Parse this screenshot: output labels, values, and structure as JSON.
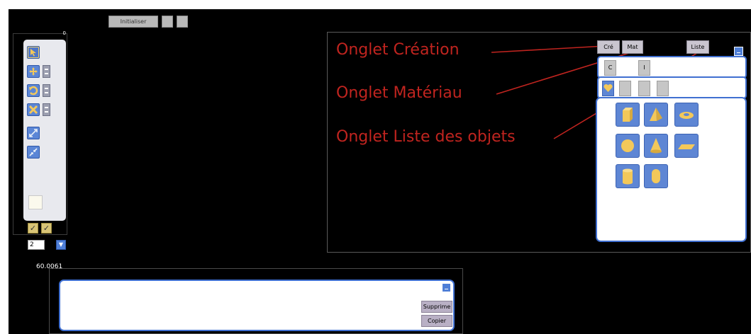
{
  "top_toolbar": {
    "buttons": [
      {
        "label": "Initialiser"
      },
      {
        "label": ""
      },
      {
        "label": ""
      }
    ]
  },
  "left_panel": {
    "top_marker": "0",
    "tools": [
      "select-arrow",
      "move",
      "rotate",
      "scale",
      "zoom-in",
      "zoom-out"
    ],
    "mode_value": "2",
    "dropdown_glyph": "▼",
    "fps": "60.0061"
  },
  "annotations": {
    "creation": "Onglet Création",
    "material": "Onglet Matériau",
    "object_list": "Onglet Liste des objets"
  },
  "right_panel": {
    "tabs": {
      "creation": "Cré",
      "material": "Mat",
      "list": "Liste"
    },
    "mode_buttons": [
      "C",
      "I"
    ],
    "category_icon": "heart-icon",
    "shapes": [
      "cube",
      "pyramid",
      "torus",
      "sphere",
      "cone",
      "plane",
      "cylinder",
      "capsule"
    ]
  },
  "bottom_panel": {
    "delete_label": "Supprime",
    "copy_label": "Copier"
  },
  "colors": {
    "accent": "#4f7fd7",
    "annotation": "#c0241f",
    "shape": "#f3c85a",
    "background": "#000000"
  }
}
